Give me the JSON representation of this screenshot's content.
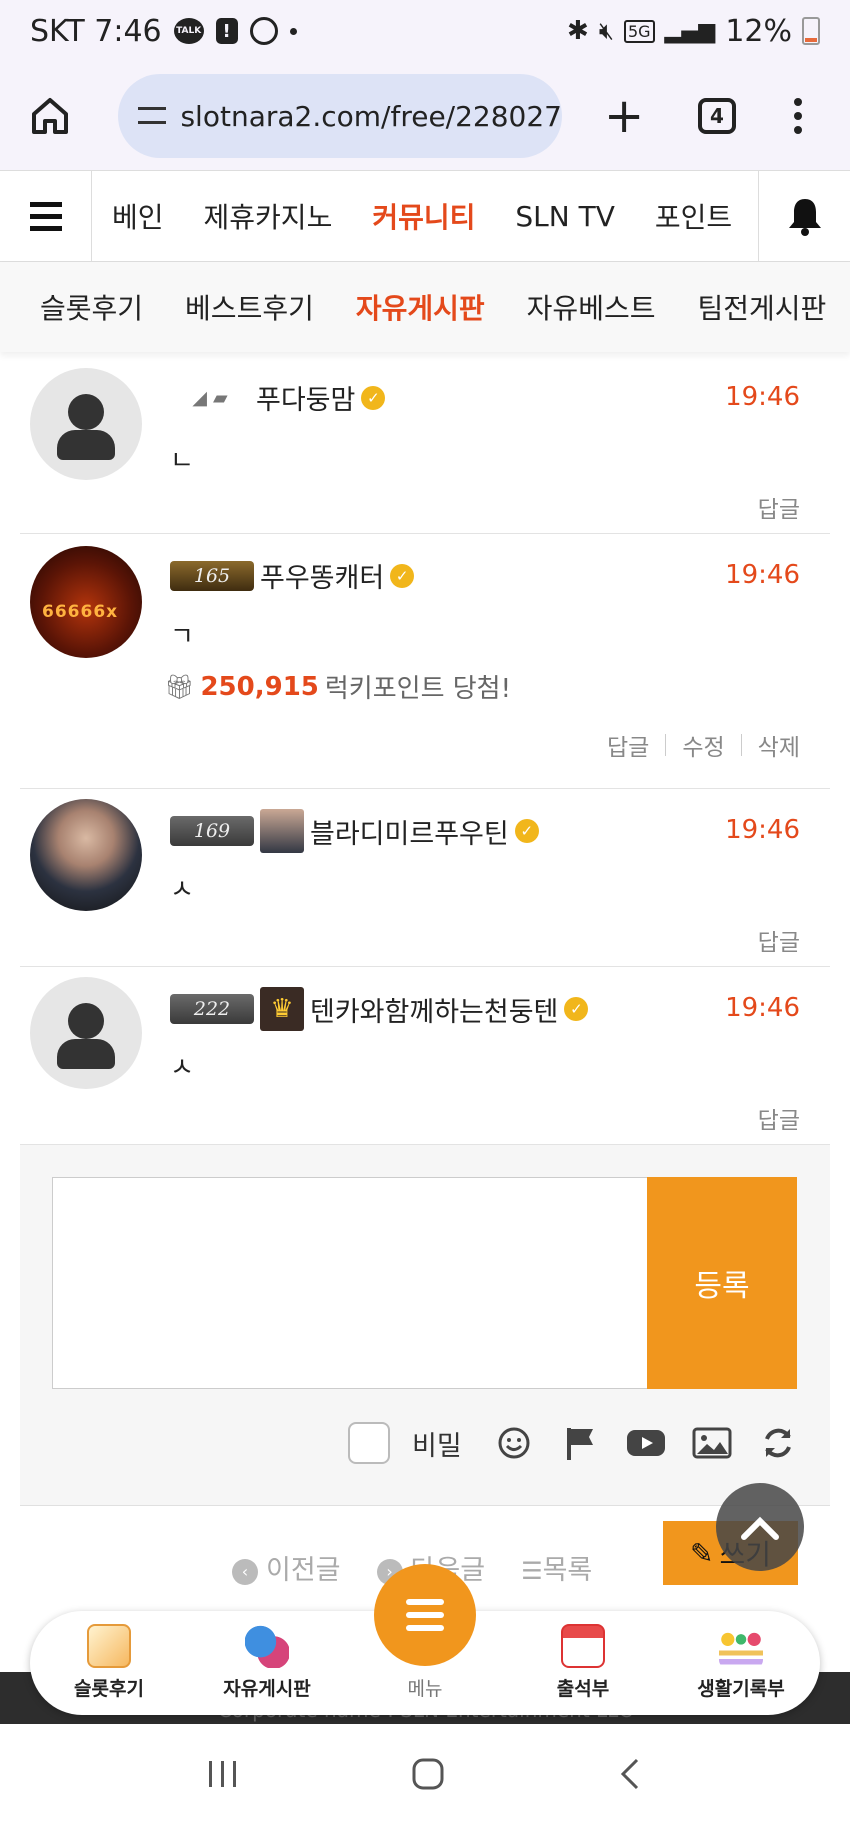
{
  "status_bar": {
    "carrier_time": "SKT 7:46",
    "talk_label": "TALK",
    "network": "5G",
    "battery": "12%"
  },
  "browser": {
    "url": "slotnara2.com/free/228027",
    "tab_count": "4"
  },
  "nav": {
    "items": [
      "베인",
      "제휴카지노",
      "커뮤니티",
      "SLN TV",
      "포인트"
    ],
    "active": "커뮤니티"
  },
  "subnav": {
    "items": [
      "슬롯후기",
      "베스트후기",
      "자유게시판",
      "자유베스트",
      "팀전게시판"
    ],
    "active": "자유게시판"
  },
  "comments": [
    {
      "name": "푸다둥맘",
      "time": "19:46",
      "text": "ㄴ",
      "actions": [
        "답글"
      ]
    },
    {
      "level": "165",
      "name": "푸우똥캐터",
      "time": "19:46",
      "text": "ㄱ",
      "avatar_text": "66666x",
      "prize_amount": "250,915",
      "prize_text": "럭키포인트 당첨!",
      "actions": [
        "답글",
        "수정",
        "삭제"
      ]
    },
    {
      "level": "169",
      "name": "블라디미르푸우틴",
      "time": "19:46",
      "text": "ㅅ",
      "actions": [
        "답글"
      ]
    },
    {
      "level": "222",
      "name": "텐카와함께하는천둥텐",
      "time": "19:46",
      "text": "ㅅ",
      "actions": [
        "답글"
      ]
    }
  ],
  "reply_form": {
    "submit_label": "등록",
    "secret_label": "비밀"
  },
  "pager": {
    "prev": "이전글",
    "next": "다음글",
    "list": "목록",
    "write": "쓰기"
  },
  "footer": {
    "text": "Corporate name : SLN Entertainment LLC"
  },
  "appbar": {
    "items": [
      "슬롯후기",
      "자유게시판",
      "메뉴",
      "출석부",
      "생활기록부"
    ]
  },
  "colors": {
    "accent": "#e4491b",
    "orange": "#f1961d"
  }
}
